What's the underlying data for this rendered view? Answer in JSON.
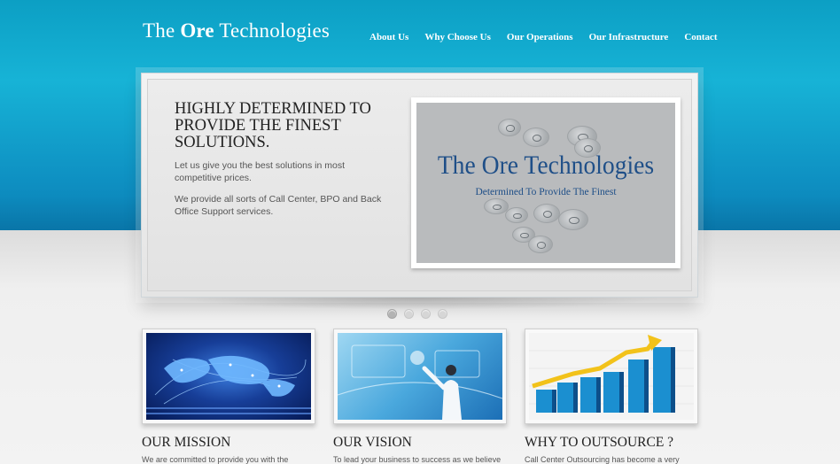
{
  "brand": {
    "name_prefix": "The ",
    "name_bold": "Ore",
    "name_suffix": " Technologies"
  },
  "nav": {
    "items": [
      "About Us",
      "Why Choose Us",
      "Our Operations",
      "Our Infrastructure",
      "Contact"
    ]
  },
  "slider": {
    "heading": "HIGHLY DETERMINED TO PROVIDE THE FINEST SOLUTIONS.",
    "paragraph_1": "Let us give you the best solutions in most competitive prices.",
    "paragraph_2": "We provide all sorts of Call Center, BPO and Back Office Support services.",
    "image_title": "The Ore Technologies",
    "image_subtitle": "Determined To Provide The Finest",
    "dot_count": 4,
    "active_dot": 0
  },
  "cards": [
    {
      "title": "OUR MISSION",
      "text": "We are committed to provide you with the"
    },
    {
      "title": "OUR VISION",
      "text": "To lead your business to success as we believe"
    },
    {
      "title": "WHY TO OUTSOURCE ?",
      "text": "Call Center Outsourcing has become a very"
    }
  ],
  "colors": {
    "header_blue": "#17b3d6",
    "logo_image_text": "#1f4f88",
    "chart_arrow": "#f2c21a",
    "chart_bars": "#1b8fd0"
  }
}
